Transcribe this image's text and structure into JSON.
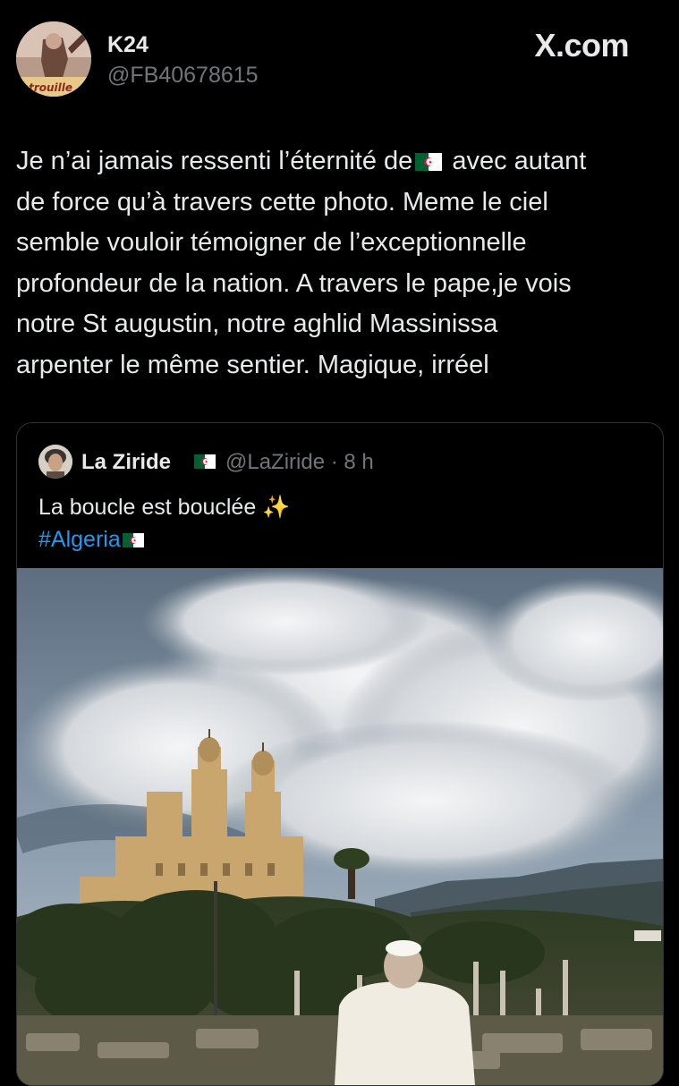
{
  "header": {
    "display_name": "K24",
    "handle": "@FB40678615",
    "brand": "X.com",
    "avatar_caption": "atrouille"
  },
  "tweet": {
    "line1_before": "Je n’ai jamais ressenti l’éternité de",
    "line1_after": "avec autant",
    "lines": [
      "de force qu’à travers cette photo. Meme le ciel",
      "semble vouloir témoigner de l’exceptionnelle",
      "profondeur de la nation. A travers le pape,je vois",
      "notre St augustin, notre aghlid Massinissa",
      "arpenter le même sentier. Magique, irréel"
    ]
  },
  "quote": {
    "display_name": "La Ziride",
    "handle_time": "@LaZiride · 8 h",
    "text": "La boucle est bouclée",
    "sparkle": "✨",
    "hashtag": "#Algeria"
  },
  "colors": {
    "background": "#000000",
    "text": "#e7e9ea",
    "muted": "#71767b",
    "link": "#1d9bf0",
    "flag_green": "#006233",
    "flag_red": "#d21034"
  },
  "icons": [
    "algeria-flag-icon",
    "sparkles-icon"
  ]
}
